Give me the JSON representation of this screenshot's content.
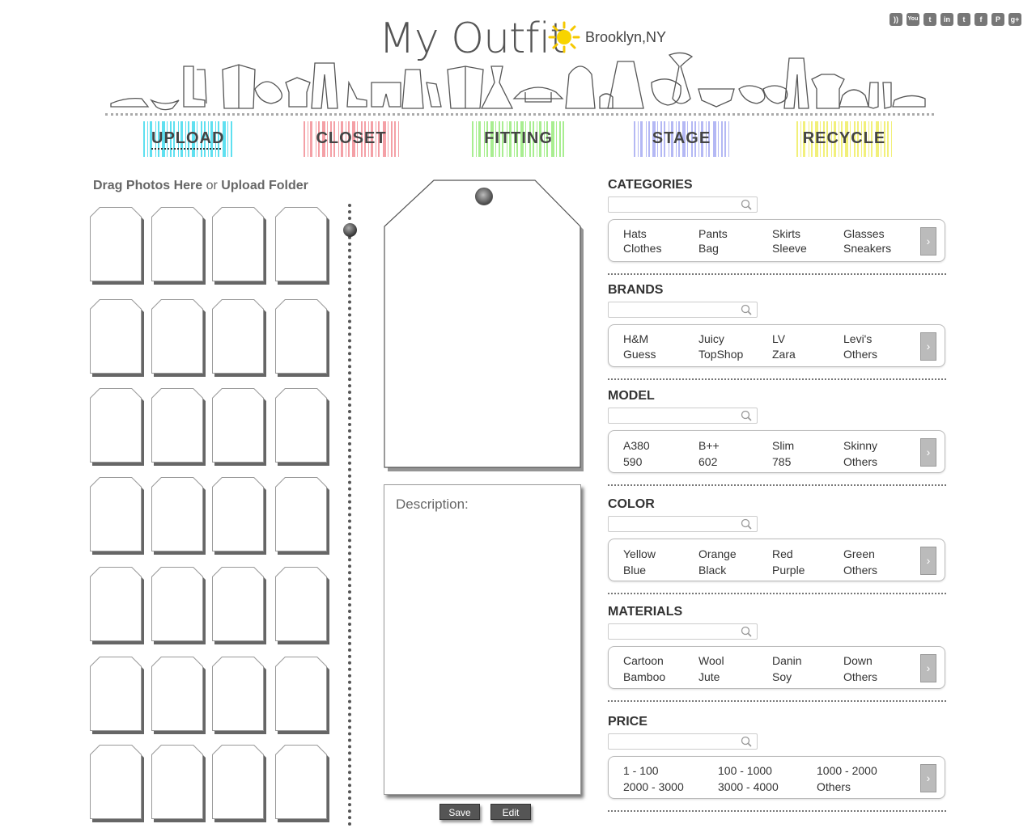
{
  "header": {
    "logo": "My Outfit",
    "location": "Brooklyn,NY",
    "social": [
      "rss-icon",
      "youtube-icon",
      "tumblr-icon",
      "linkedin-icon",
      "twitter-icon",
      "facebook-icon",
      "pinterest-icon",
      "googleplus-icon"
    ],
    "social_glyphs": [
      "))",
      "You",
      "t",
      "in",
      "t",
      "f",
      "P",
      "g+"
    ]
  },
  "nav": {
    "upload": "UPLOAD",
    "closet": "CLOSET",
    "fitting": "FITTING",
    "stage": "STAGE",
    "recycle": "RECYCLE",
    "colors": {
      "upload": "#5fe0f0",
      "closet": "#f4a0a6",
      "fitting": "#a8ee90",
      "stage": "#b4b8f4",
      "recycle": "#f2f07a"
    }
  },
  "left": {
    "drag_label": "Drag Photos Here",
    "or": "or",
    "upload_folder": "Upload Folder"
  },
  "center": {
    "description_label": "Description:",
    "save": "Save",
    "edit": "Edit"
  },
  "filters": {
    "categories": {
      "title": "CATEGORIES",
      "options": [
        "Hats",
        "Pants",
        "Skirts",
        "Glasses",
        "Clothes",
        "Bag",
        "Sleeve",
        "Sneakers"
      ]
    },
    "brands": {
      "title": "BRANDS",
      "options": [
        "H&M",
        "Juicy",
        "LV",
        "Levi's",
        "Guess",
        "TopShop",
        "Zara",
        "Others"
      ]
    },
    "model": {
      "title": "MODEL",
      "options": [
        "A380",
        "B++",
        "Slim",
        "Skinny",
        "590",
        "602",
        "785",
        "Others"
      ]
    },
    "color": {
      "title": "COLOR",
      "options": [
        "Yellow",
        "Orange",
        "Red",
        "Green",
        "Blue",
        "Black",
        "Purple",
        "Others"
      ]
    },
    "materials": {
      "title": "MATERIALS",
      "options": [
        "Cartoon",
        "Wool",
        "Danin",
        "Down",
        "Bamboo",
        "Jute",
        "Soy",
        "Others"
      ]
    },
    "price": {
      "title": "PRICE",
      "options": [
        "1 - 100",
        "100 - 1000",
        "1000 - 2000",
        "2000 - 3000",
        "3000 - 4000",
        "Others"
      ]
    }
  }
}
